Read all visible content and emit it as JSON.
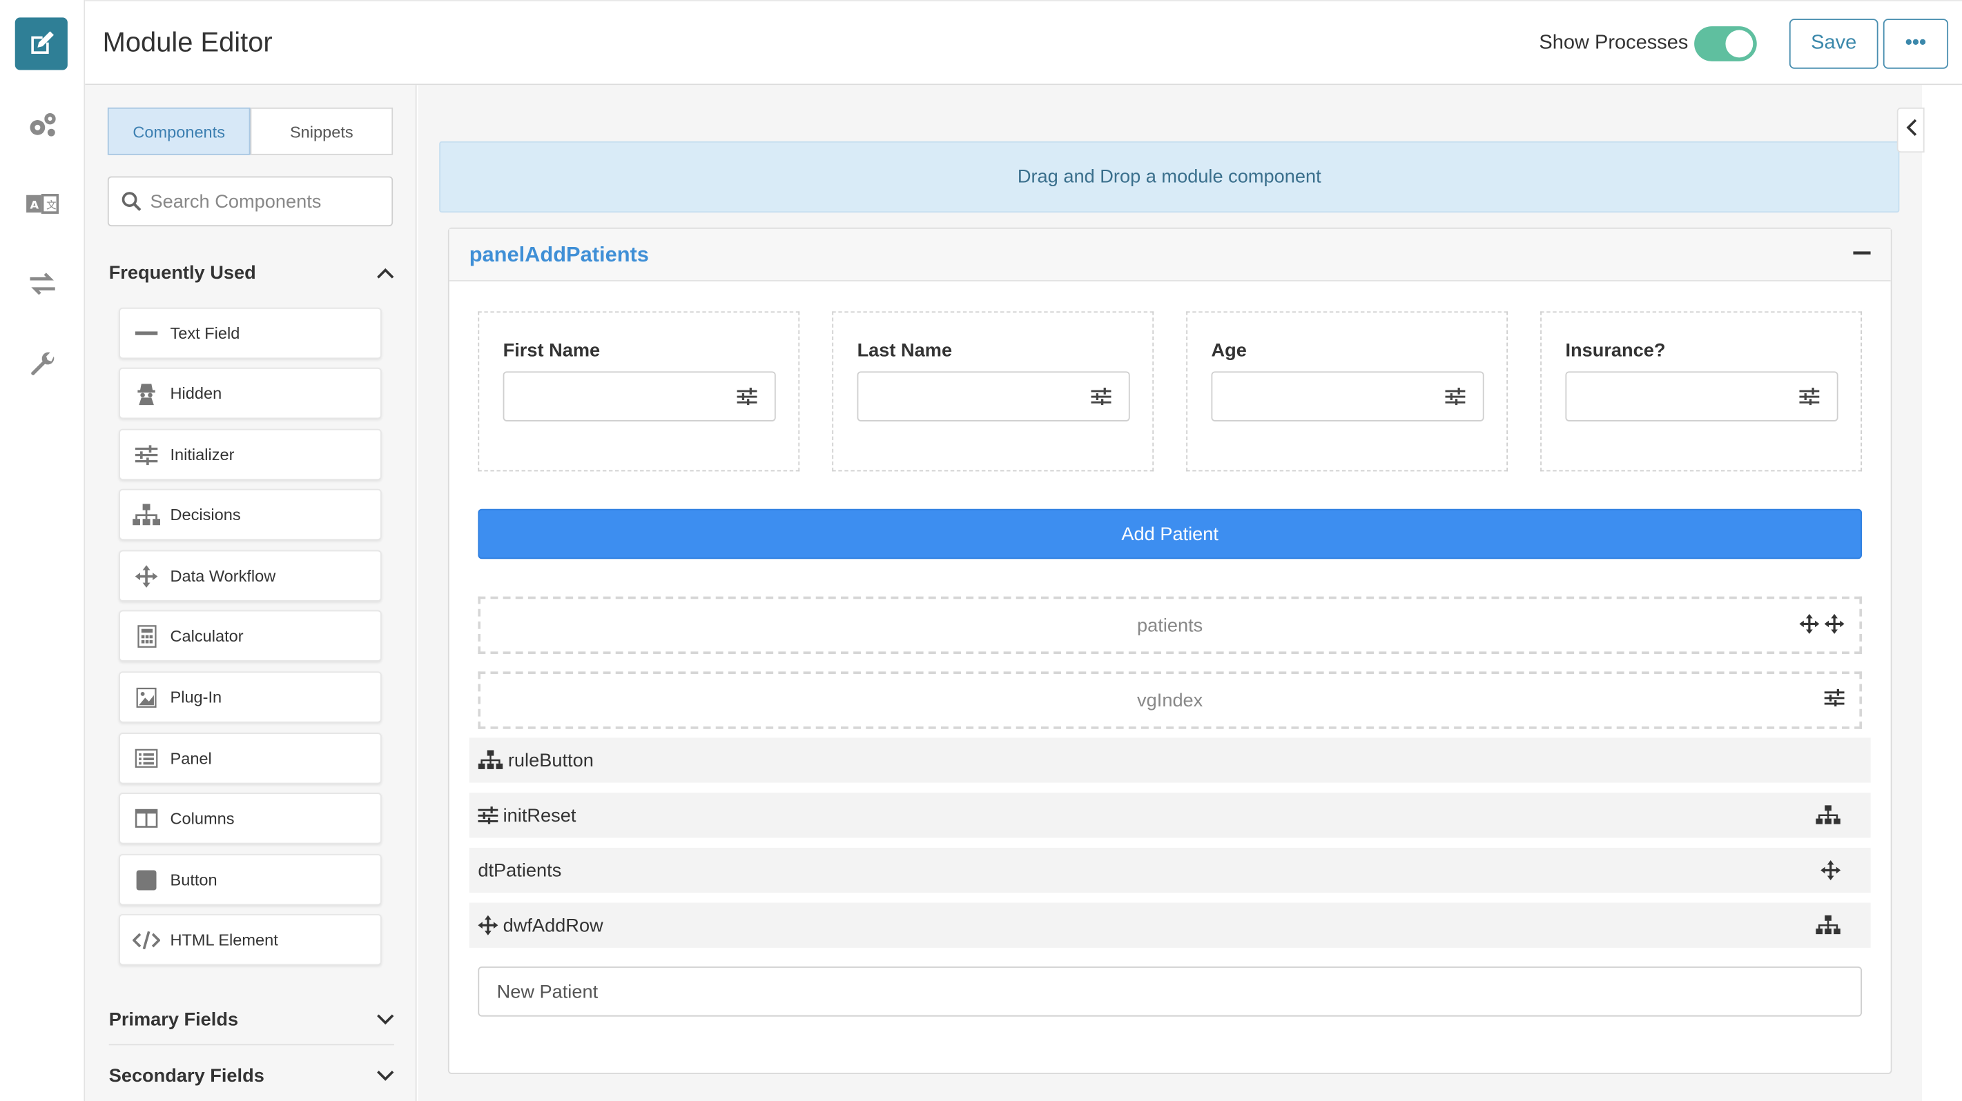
{
  "header": {
    "title": "Module Editor",
    "show_processes_label": "Show Processes",
    "show_processes_on": true,
    "save_label": "Save",
    "more_label": "•••"
  },
  "rail": {
    "items": [
      {
        "icon": "edit-icon",
        "active": true
      },
      {
        "icon": "gears-icon"
      },
      {
        "icon": "translate-icon"
      },
      {
        "icon": "exchange-arrows-icon"
      },
      {
        "icon": "wrench-icon"
      }
    ]
  },
  "sidebar": {
    "tabs": [
      {
        "label": "Components",
        "active": true
      },
      {
        "label": "Snippets",
        "active": false
      }
    ],
    "search_placeholder": "Search Components",
    "sections": {
      "frequently_used": "Frequently Used",
      "primary_fields": "Primary Fields",
      "secondary_fields": "Secondary Fields"
    },
    "components": [
      {
        "label": "Text Field",
        "icon": "minus-icon"
      },
      {
        "label": "Hidden",
        "icon": "user-secret-icon"
      },
      {
        "label": "Initializer",
        "icon": "sliders-icon"
      },
      {
        "label": "Decisions",
        "icon": "sitemap-icon"
      },
      {
        "label": "Data Workflow",
        "icon": "move-arrows-icon"
      },
      {
        "label": "Calculator",
        "icon": "calculator-icon"
      },
      {
        "label": "Plug-In",
        "icon": "image-icon"
      },
      {
        "label": "Panel",
        "icon": "list-alt-icon"
      },
      {
        "label": "Columns",
        "icon": "columns-icon"
      },
      {
        "label": "Button",
        "icon": "stop-square-icon"
      },
      {
        "label": "HTML Element",
        "icon": "code-icon"
      }
    ]
  },
  "canvas": {
    "dropzone_text": "Drag and Drop a module component",
    "panel_title": "panelAddPatients",
    "fields": [
      {
        "label": "First Name",
        "value": ""
      },
      {
        "label": "Last Name",
        "value": ""
      },
      {
        "label": "Age",
        "value": ""
      },
      {
        "label": "Insurance?",
        "value": ""
      }
    ],
    "add_button_label": "Add Patient",
    "dashed_rows": [
      {
        "label": "patients",
        "icon": "move-arrows-icon"
      },
      {
        "label": "vgIndex",
        "icon": "sliders-icon"
      }
    ],
    "process_rows": [
      {
        "label": "ruleButton",
        "left_icon": "sitemap-icon",
        "right_icon": ""
      },
      {
        "label": "initReset",
        "left_icon": "sliders-icon",
        "right_icon": "sitemap-icon"
      },
      {
        "label": "dtPatients",
        "left_icon": "",
        "right_icon": "move-arrows-icon"
      },
      {
        "label": "dwfAddRow",
        "left_icon": "move-arrows-icon",
        "right_icon": "sitemap-icon"
      }
    ],
    "text_input_placeholder": "New Patient"
  },
  "colors": {
    "brand": "#2f7f96",
    "accent_blue": "#3d8ef0",
    "toggle_on": "#5fbf9f",
    "panel_title": "#3f8fd6"
  }
}
